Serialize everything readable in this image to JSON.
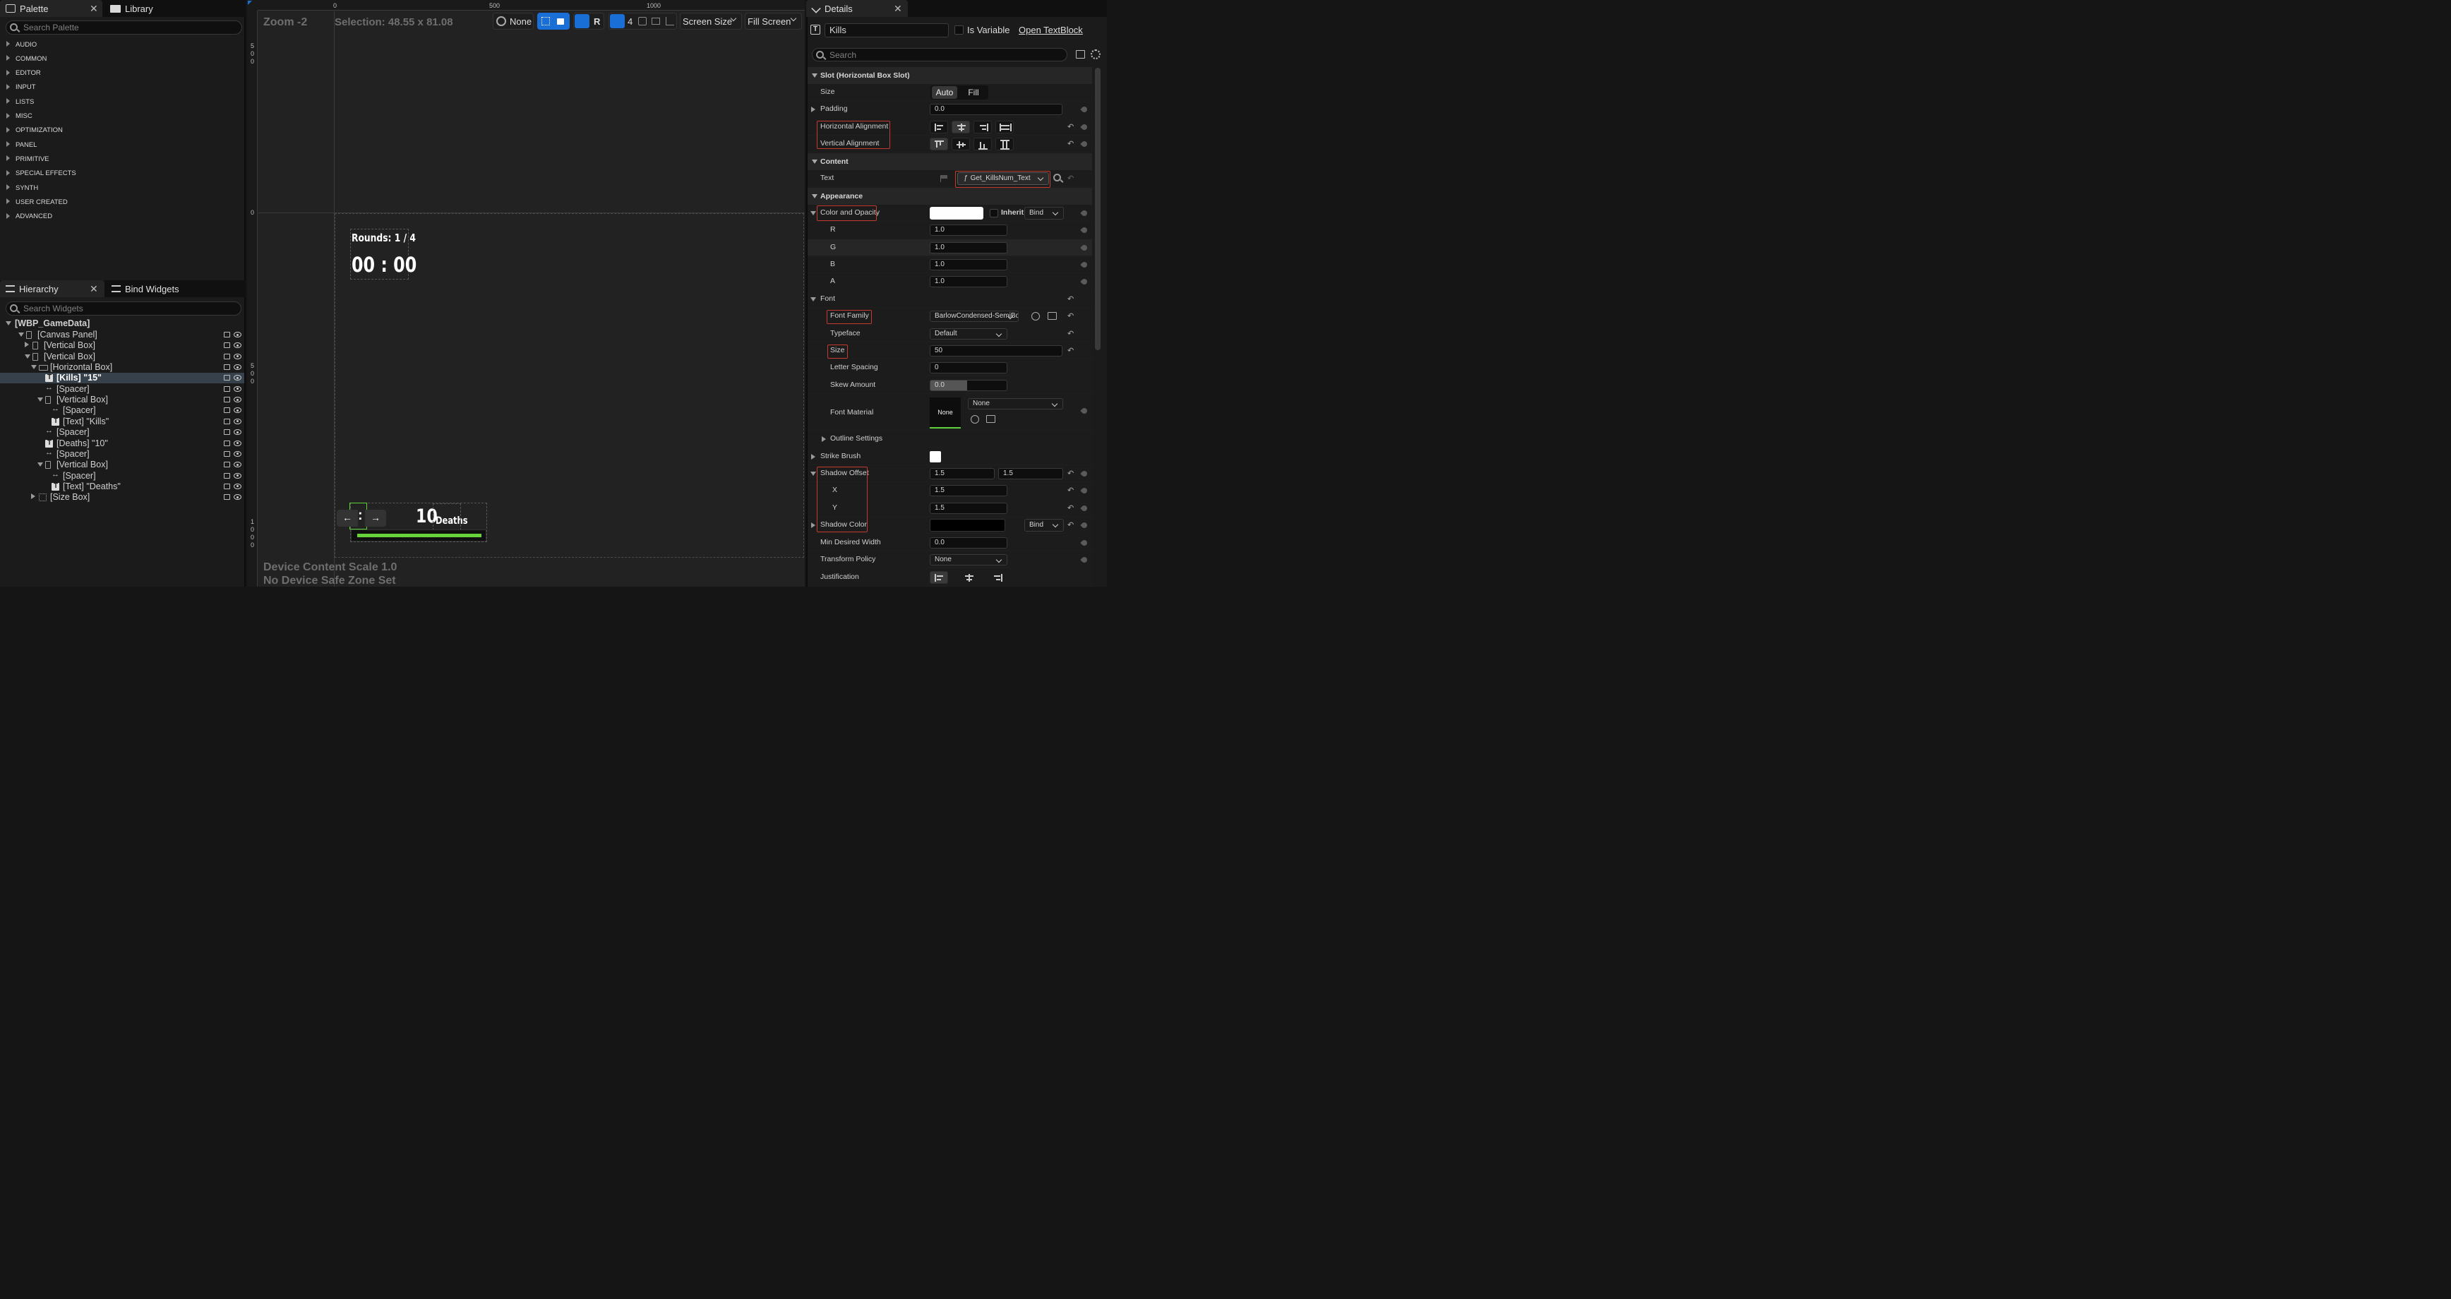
{
  "palette": {
    "tab_label": "Palette",
    "library_tab_label": "Library",
    "search_placeholder": "Search Palette",
    "categories": [
      "AUDIO",
      "COMMON",
      "EDITOR",
      "INPUT",
      "LISTS",
      "MISC",
      "OPTIMIZATION",
      "PANEL",
      "PRIMITIVE",
      "SPECIAL EFFECTS",
      "SYNTH",
      "USER CREATED",
      "ADVANCED"
    ]
  },
  "hierarchy": {
    "tab_label": "Hierarchy",
    "bind_tab_label": "Bind Widgets",
    "search_placeholder": "Search Widgets",
    "root": "[WBP_GameData]",
    "items": [
      {
        "label": "[Canvas Panel]",
        "indent": 1,
        "expand": "down",
        "icon": "box"
      },
      {
        "label": "[Vertical Box]",
        "indent": 2,
        "expand": "right",
        "icon": "box"
      },
      {
        "label": "[Vertical Box]",
        "indent": 2,
        "expand": "down",
        "icon": "box"
      },
      {
        "label": "[Horizontal Box]",
        "indent": 3,
        "expand": "down",
        "icon": "hbox"
      },
      {
        "label": "[Kills] \"15\"",
        "indent": 4,
        "expand": "",
        "icon": "text",
        "selected": true
      },
      {
        "label": "[Spacer]",
        "indent": 4,
        "expand": "",
        "icon": "spacer"
      },
      {
        "label": "[Vertical Box]",
        "indent": 4,
        "expand": "down",
        "icon": "box"
      },
      {
        "label": "[Spacer]",
        "indent": 5,
        "expand": "",
        "icon": "spacer"
      },
      {
        "label": "[Text] \"Kills\"",
        "indent": 5,
        "expand": "",
        "icon": "text"
      },
      {
        "label": "[Spacer]",
        "indent": 4,
        "expand": "",
        "icon": "spacer"
      },
      {
        "label": "[Deaths] \"10\"",
        "indent": 4,
        "expand": "",
        "icon": "text"
      },
      {
        "label": "[Spacer]",
        "indent": 4,
        "expand": "",
        "icon": "spacer"
      },
      {
        "label": "[Vertical Box]",
        "indent": 4,
        "expand": "down",
        "icon": "box"
      },
      {
        "label": "[Spacer]",
        "indent": 5,
        "expand": "",
        "icon": "spacer"
      },
      {
        "label": "[Text] \"Deaths\"",
        "indent": 5,
        "expand": "",
        "icon": "text"
      },
      {
        "label": "[Size Box]",
        "indent": 3,
        "expand": "right",
        "icon": "sizebox"
      }
    ]
  },
  "viewport": {
    "zoom": "Zoom -2",
    "selection": "Selection: 48.55 x 81.08",
    "ruler_top": [
      "0",
      "500",
      "1000"
    ],
    "ruler_left": [
      "5\n0\n0",
      "0",
      "5\n0\n0",
      "1\n0\n0\n0"
    ],
    "toolbar": {
      "none_label": "None",
      "r_label": "R",
      "grid_count": "4",
      "screen_size": "Screen Size",
      "fill_screen": "Fill Screen"
    },
    "rounds_text": "Rounds: 1 / 4",
    "timer_text": "00 : 00",
    "deaths_num": "10",
    "deaths_label": "Deaths",
    "kills_fragment": ":",
    "device_scale": "Device Content Scale 1.0",
    "safe_zone": "No Device Safe Zone Set",
    "health_fill": 1.0,
    "colors": {
      "selection_green": "#5fcf3a",
      "bar_green": "#68d23c"
    }
  },
  "details": {
    "tab_label": "Details",
    "name_value": "Kills",
    "is_variable_label": "Is Variable",
    "open_link": "Open TextBlock",
    "search_placeholder": "Search",
    "sections": {
      "slot": "Slot (Horizontal Box Slot)",
      "content": "Content",
      "appearance": "Appearance"
    },
    "size_label": "Size",
    "size_auto": "Auto",
    "size_fill": "Fill",
    "padding_label": "Padding",
    "padding_value": "0.0",
    "halign_label": "Horizontal Alignment",
    "valign_label": "Vertical Alignment",
    "text_label": "Text",
    "text_binding": "Get_KillsNum_Text",
    "color_label": "Color and Opacity",
    "inherit_label": "Inherit",
    "bind_label": "Bind",
    "r_label": "R",
    "r_value": "1.0",
    "g_label": "G",
    "g_value": "1.0",
    "b_label": "B",
    "b_value": "1.0",
    "a_label": "A",
    "a_value": "1.0",
    "font_label": "Font",
    "font_family_label": "Font Family",
    "font_family_value": "BarlowCondensed-SemiBold",
    "typeface_label": "Typeface",
    "typeface_value": "Default",
    "font_size_label": "Size",
    "font_size_value": "50",
    "letter_spacing_label": "Letter Spacing",
    "letter_spacing_value": "0",
    "skew_label": "Skew Amount",
    "skew_value": "0.0",
    "font_material_label": "Font Material",
    "font_material_thumb": "None",
    "font_material_value": "None",
    "outline_label": "Outline Settings",
    "strike_label": "Strike Brush",
    "shadow_offset_label": "Shadow Offset",
    "shadow_offset_x": "1.5",
    "shadow_offset_y": "1.5",
    "x_label": "X",
    "x_value": "1.5",
    "y_label": "Y",
    "y_value": "1.5",
    "shadow_color_label": "Shadow Color",
    "shadow_bind_label": "Bind",
    "min_width_label": "Min Desired Width",
    "min_width_value": "0.0",
    "transform_label": "Transform Policy",
    "transform_value": "None",
    "justification_label": "Justification",
    "colors": {
      "highlight_red": "#c43a2f",
      "accent_blue": "#1a6fd6"
    }
  }
}
